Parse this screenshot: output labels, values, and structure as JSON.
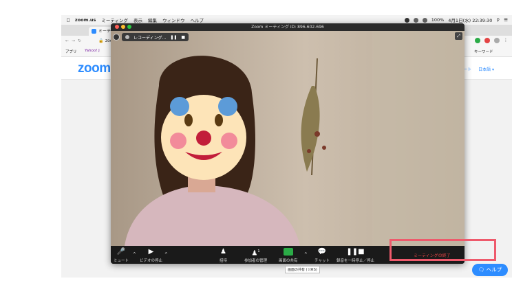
{
  "menubar": {
    "app": "zoom.us",
    "items": [
      "ミーティング",
      "表示",
      "編集",
      "ウィンドウ",
      "ヘルプ"
    ],
    "battery": "100%",
    "datetime": "4月1日(水) 22:39:30"
  },
  "browser": {
    "tab_title": "ミーティ",
    "url": "zoo",
    "bookmarks": [
      "アプリ",
      "Yahoo! J"
    ],
    "bookmark_right": "キーワード"
  },
  "zoom_site": {
    "logo": "zoom",
    "nav_suffix": "ート",
    "language": "日本語 ▾",
    "help_label": "ヘルプ"
  },
  "meeting": {
    "title": "Zoom ミーティング ID: 896-602-696",
    "recording_label": "レコーディング...",
    "toolbar": {
      "mute": "ミュート",
      "stop_video": "ビデオの停止",
      "invite": "招待",
      "manage_participants": "参加者の管理",
      "participant_count": "1",
      "share_screen": "画面の共有",
      "chat": "チャット",
      "pause_recording": "録音を一時停止／停止",
      "end_meeting": "ミーティングの終了"
    },
    "share_tooltip": "画面の共有 (⇧⌘S)"
  },
  "colors": {
    "zoom_blue": "#2d8cff",
    "share_green": "#2bab47",
    "end_red": "#e34444",
    "highlight_box": "#ee5a6c"
  }
}
